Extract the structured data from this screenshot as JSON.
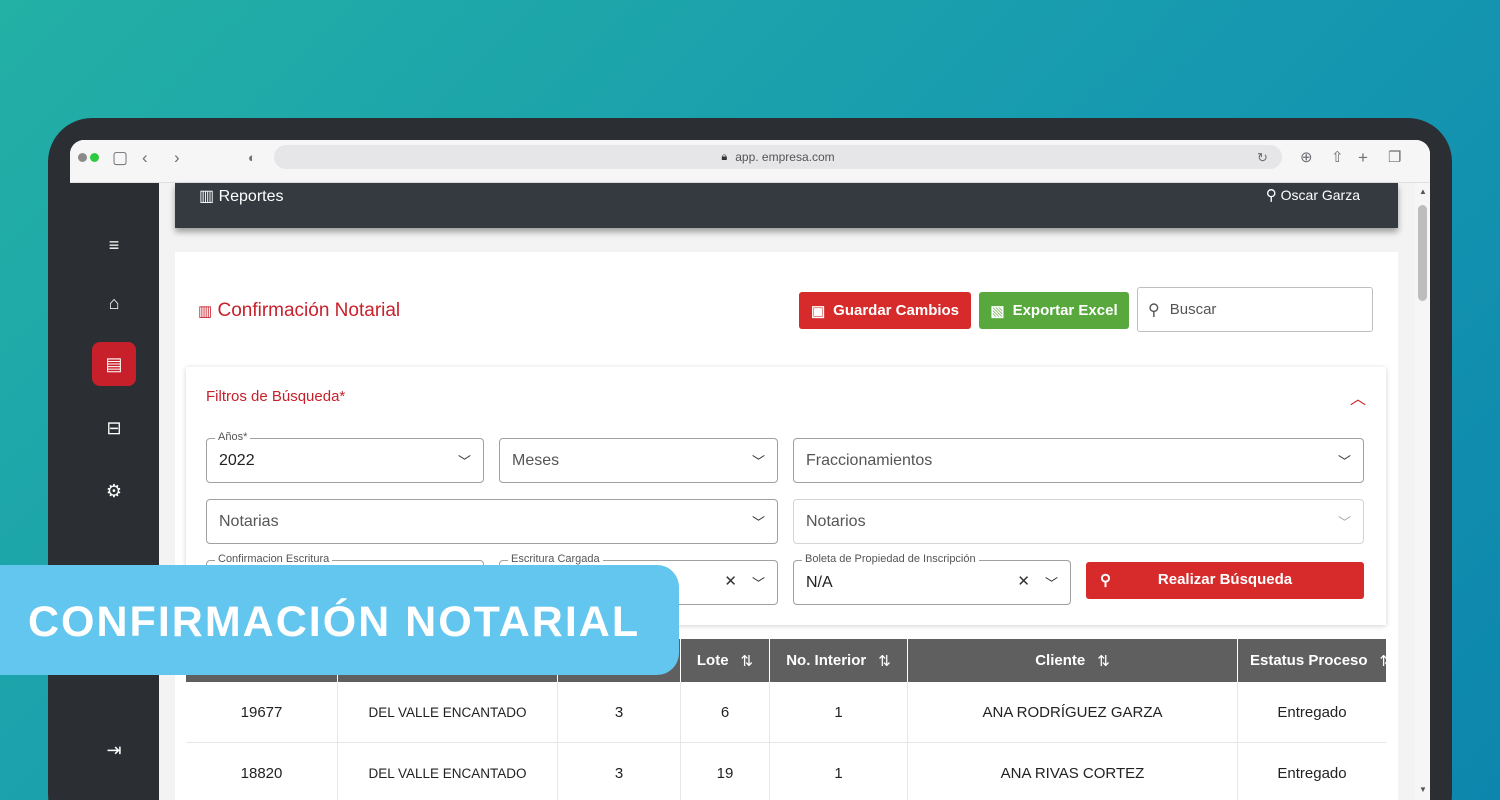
{
  "browser": {
    "url": "app. empresa.com"
  },
  "topbar": {
    "brand": "Reportes",
    "user": "Oscar Garza"
  },
  "sidebar": {
    "items": [
      {
        "icon": "menu-icon"
      },
      {
        "icon": "home-icon"
      },
      {
        "icon": "inbox-icon",
        "active": true
      },
      {
        "icon": "briefcase-icon"
      },
      {
        "icon": "gear-icon"
      },
      {
        "icon": "logout-icon"
      }
    ]
  },
  "page": {
    "title": "Confirmación Notarial",
    "save_label": "Guardar Cambios",
    "export_label": "Exportar Excel",
    "search_placeholder": "Buscar"
  },
  "filters": {
    "title": "Filtros de Búsqueda*",
    "anios": {
      "label": "Años*",
      "value": "2022"
    },
    "meses": {
      "placeholder": "Meses"
    },
    "fraccionamientos": {
      "placeholder": "Fraccionamientos"
    },
    "notarias": {
      "placeholder": "Notarias"
    },
    "notarios": {
      "placeholder": "Notarios"
    },
    "confirmacion": {
      "label": "Confirmacion Escritura"
    },
    "escritura": {
      "label": "Escritura Cargada"
    },
    "boleta": {
      "label": "Boleta de Propiedad de Inscripción",
      "value": "N/A"
    },
    "search_button": "Realizar Búsqueda"
  },
  "table": {
    "headers": {
      "lote": "Lote",
      "interior": "No. Interior",
      "cliente": "Cliente",
      "estatus": "Estatus Proceso"
    },
    "rows": [
      {
        "id": "19677",
        "fraccionamiento": "DEL VALLE ENCANTADO",
        "manzana": "3",
        "lote": "6",
        "interior": "1",
        "cliente": "ANA RODRÍGUEZ GARZA",
        "estatus": "Entregado"
      },
      {
        "id": "18820",
        "fraccionamiento": "DEL VALLE ENCANTADO",
        "manzana": "3",
        "lote": "19",
        "interior": "1",
        "cliente": "ANA RIVAS CORTEZ",
        "estatus": "Entregado"
      }
    ]
  },
  "banner": {
    "text": "CONFIRMACIÓN NOTARIAL"
  },
  "colors": {
    "accent": "#c8202a",
    "green": "#58a83e",
    "dark": "#343a40",
    "banner": "#63c6ee"
  }
}
